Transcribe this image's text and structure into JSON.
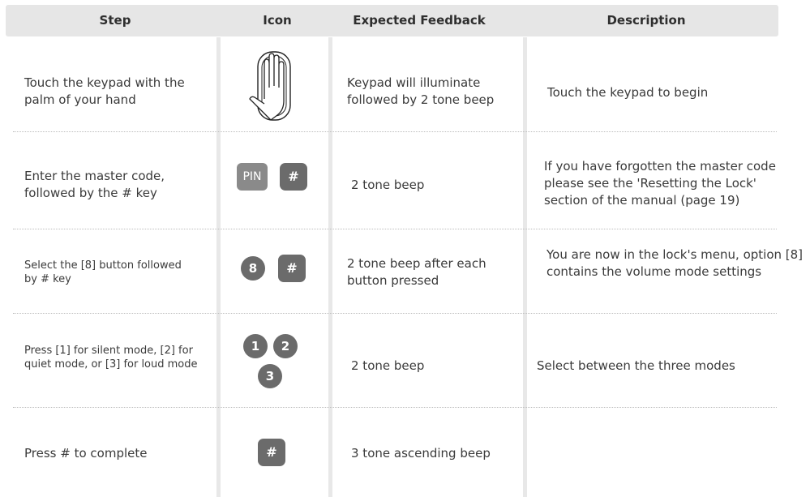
{
  "headers": [
    "Step",
    "Icon",
    "Expected Feedback",
    "Description"
  ],
  "rows": [
    {
      "step": "Touch the keypad with the palm of your hand",
      "icon": "palm-on-keypad",
      "feedback": "Keypad will illuminate followed by 2 tone beep",
      "description": "Touch the keypad to begin"
    },
    {
      "step": "Enter the master code, followed by the # key",
      "icon_keys": [
        "PIN",
        "#"
      ],
      "feedback": "2 tone beep",
      "description": "If you have forgotten the master code please see the 'Resetting the Lock' section of the manual (page 19)"
    },
    {
      "step": "Select the [8] button followed by # key",
      "icon_keys": [
        "8",
        "#"
      ],
      "feedback": "2 tone beep after each button pressed",
      "description": "You are now in the lock's menu, option [8] contains the volume mode settings"
    },
    {
      "step": "Press [1] for silent mode, [2] for quiet mode, or [3] for loud mode",
      "icon_keys": [
        "1",
        "2",
        "3"
      ],
      "feedback": "2 tone beep",
      "description": "Select between the three modes"
    },
    {
      "step": "Press # to complete",
      "icon_keys": [
        "#"
      ],
      "feedback": "3 tone ascending beep",
      "description": ""
    }
  ],
  "colors": {
    "header_bg": "#e6e6e6",
    "key_bg": "#6b6b6b",
    "divider": "#e8e8e8"
  }
}
